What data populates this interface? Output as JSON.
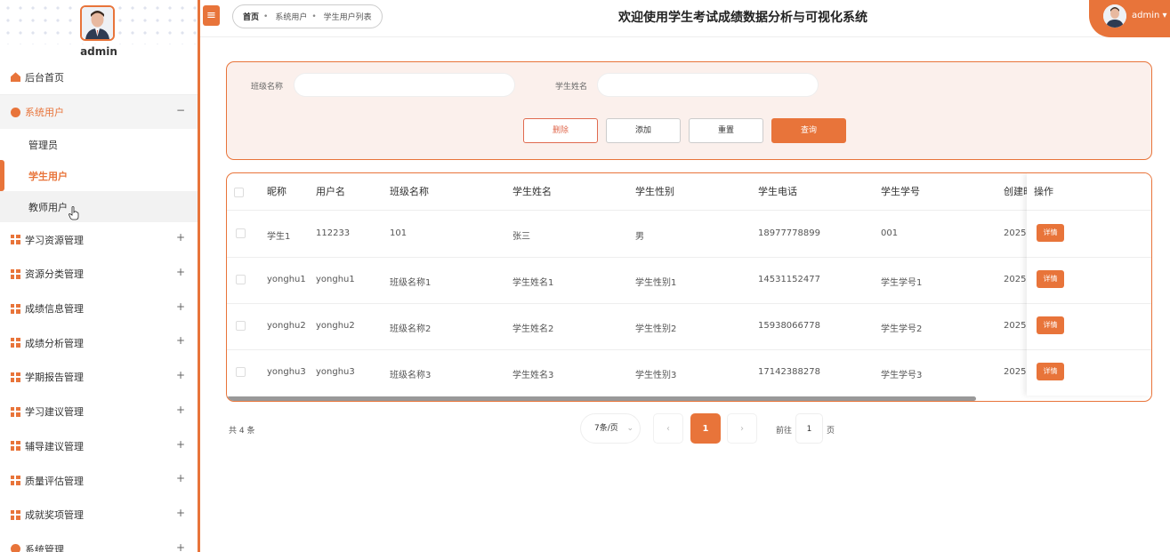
{
  "sidebar": {
    "username": "admin",
    "menu": [
      {
        "label": "后台首页",
        "icon": "home-icon"
      },
      {
        "label": "系统用户",
        "icon": "user-circle-icon",
        "toggle": "−",
        "children": [
          "管理员",
          "学生用户",
          "教师用户"
        ]
      },
      {
        "label": "学习资源管理",
        "icon": "grid-icon",
        "toggle": "+"
      },
      {
        "label": "资源分类管理",
        "icon": "grid-icon",
        "toggle": "+"
      },
      {
        "label": "成绩信息管理",
        "icon": "grid-icon",
        "toggle": "+"
      },
      {
        "label": "成绩分析管理",
        "icon": "grid-icon",
        "toggle": "+"
      },
      {
        "label": "学期报告管理",
        "icon": "grid-icon",
        "toggle": "+"
      },
      {
        "label": "学习建议管理",
        "icon": "grid-icon",
        "toggle": "+"
      },
      {
        "label": "辅导建议管理",
        "icon": "grid-icon",
        "toggle": "+"
      },
      {
        "label": "质量评估管理",
        "icon": "grid-icon",
        "toggle": "+"
      },
      {
        "label": "成就奖项管理",
        "icon": "grid-icon",
        "toggle": "+"
      },
      {
        "label": "系统管理",
        "icon": "gear-icon",
        "toggle": "+"
      }
    ]
  },
  "topbar": {
    "menu_icon": "≡",
    "breadcrumb": [
      "首页",
      "系统用户",
      "学生用户列表"
    ],
    "title": "欢迎使用学生考试成绩数据分析与可视化系统",
    "user": "admin"
  },
  "search": {
    "class_label": "班级名称",
    "class_value": "",
    "name_label": "学生姓名",
    "name_value": "",
    "delete": "删除",
    "add": "添加",
    "reset": "重置",
    "query": "查询"
  },
  "table": {
    "headers": [
      "昵称",
      "用户名",
      "班级名称",
      "学生姓名",
      "学生性别",
      "学生电话",
      "学生学号",
      "创建时",
      "操作"
    ],
    "rows": [
      [
        "学生1",
        "112233",
        "101",
        "张三",
        "男",
        "18977778899",
        "001",
        "2025-"
      ],
      [
        "yonghu1",
        "yonghu1",
        "班级名称1",
        "学生姓名1",
        "学生性别1",
        "14531152477",
        "学生学号1",
        "2025-"
      ],
      [
        "yonghu2",
        "yonghu2",
        "班级名称2",
        "学生姓名2",
        "学生性别2",
        "15938066778",
        "学生学号2",
        "2025-"
      ],
      [
        "yonghu3",
        "yonghu3",
        "班级名称3",
        "学生姓名3",
        "学生性别3",
        "17142388278",
        "学生学号3",
        "2025-"
      ]
    ],
    "detail_label": "详情"
  },
  "pagination": {
    "total": "共 4 条",
    "page_size": "7条/页",
    "prev": "‹",
    "current": "1",
    "next": "›",
    "goto_label": "前往",
    "goto_value": "1",
    "page_suffix": "页"
  },
  "colors": {
    "accent": "#e8743a"
  }
}
